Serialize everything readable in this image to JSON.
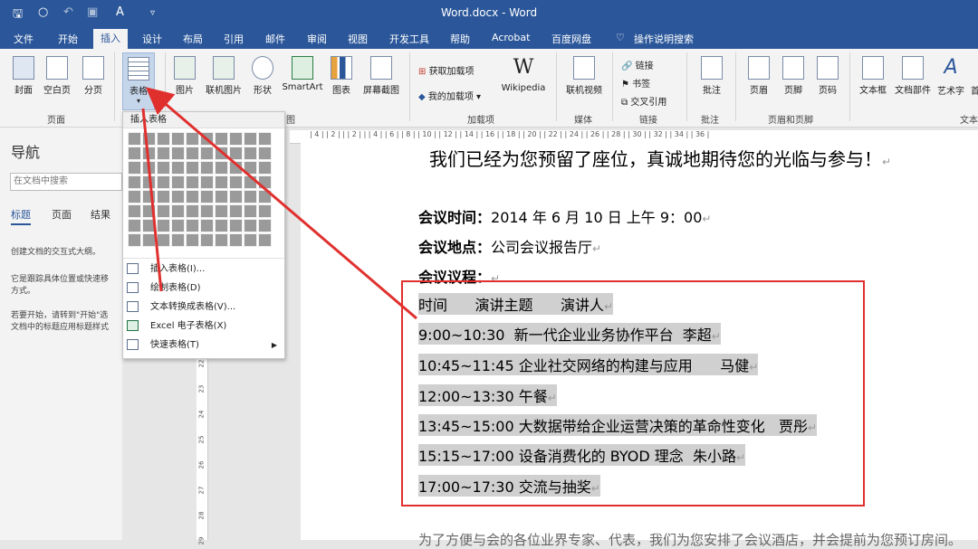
{
  "window": {
    "title": "Word.docx  -  Word",
    "quick_access": [
      "save-icon",
      "circle-icon",
      "undo-icon",
      "redo-icon",
      "font-icon",
      "customize-icon"
    ]
  },
  "tabs": [
    "文件",
    "开始",
    "插入",
    "设计",
    "布局",
    "引用",
    "邮件",
    "审阅",
    "视图",
    "开发工具",
    "帮助",
    "Acrobat",
    "百度网盘"
  ],
  "tell_me": "操作说明搜索",
  "ribbon": {
    "pages_group": {
      "label": "页面",
      "buttons": [
        "封面",
        "空白页",
        "分页"
      ]
    },
    "table_button": "表格",
    "illustrations": {
      "buttons": [
        "图片",
        "联机图片",
        "形状",
        "SmartArt",
        "图表",
        "屏幕截图"
      ],
      "label_partial": "图"
    },
    "addins": {
      "label": "加载项",
      "items": [
        "获取加载项",
        "我的加载项"
      ],
      "wikipedia": "Wikipedia"
    },
    "media": {
      "label": "媒体",
      "button": "联机视频"
    },
    "links": {
      "label": "链接",
      "items": [
        "链接",
        "书签",
        "交叉引用"
      ]
    },
    "comments": {
      "label": "批注",
      "button": "批注"
    },
    "header_footer": {
      "label": "页眉和页脚",
      "buttons": [
        "页眉",
        "页脚",
        "页码"
      ]
    },
    "text": {
      "label": "文本",
      "buttons": [
        "文本框",
        "文档部件",
        "艺术字",
        "首"
      ]
    }
  },
  "nav": {
    "title": "导航",
    "search_placeholder": "在文档中搜索",
    "tabs": [
      "标题",
      "页面",
      "结果"
    ],
    "p1": "创建文档的交互式大纲。",
    "p2a": "它是跟踪具体位置或快速移",
    "p2b": "方式。",
    "p3a": "若要开始，请转到\"开始\"选",
    "p3b": "文档中的标题应用标题样式"
  },
  "table_menu": {
    "header": "插入表格",
    "grid_cols": 10,
    "grid_rows": 8,
    "items": [
      "插入表格(I)...",
      "绘制表格(D)",
      "文本转换成表格(V)...",
      "Excel 电子表格(X)",
      "快速表格(T)"
    ]
  },
  "ruler_marks": "| 4 | | 2 | | | 2 | | | 4 | | 6 | | 8 | | 10 | | 12 | | 14 | | 16 | | 18 | | 20 | | 22 | | 24 | | 26 | | 28 | | 30 | | 32 | | 34 | | 36 |",
  "vruler_marks": [
    "22",
    "23",
    "24",
    "25",
    "26",
    "27",
    "28",
    "29"
  ],
  "doc": {
    "top_line": "我们已经为您预留了座位，真诚地期待您的光临与参与！",
    "time_label": "会议时间：",
    "time_value": "2014 年 6 月 10 日 上午 9：00",
    "place_label": "会议地点：",
    "place_value": "公司会议报告厅",
    "agenda_label": "会议议程：",
    "rows": [
      "时间      演讲主题      演讲人",
      "9:00~10:30  新一代企业业务协作平台  李超",
      "10:45~11:45 企业社交网络的构建与应用      马健",
      "12:00~13:30 午餐",
      "13:45~15:00 大数据带给企业运营决策的革命性变化   贾彤",
      "15:15~17:00 设备消费化的 BYOD 理念  朱小路",
      "17:00~17:30 交流与抽奖"
    ],
    "bottom_line": "为了方便与会的各位业界专家、代表，我们为您安排了会议酒店，并会提前为您预订房间。"
  },
  "colors": {
    "accent": "#2b579a",
    "highlight": "#d0d0d0",
    "annotation": "#e0302e"
  }
}
